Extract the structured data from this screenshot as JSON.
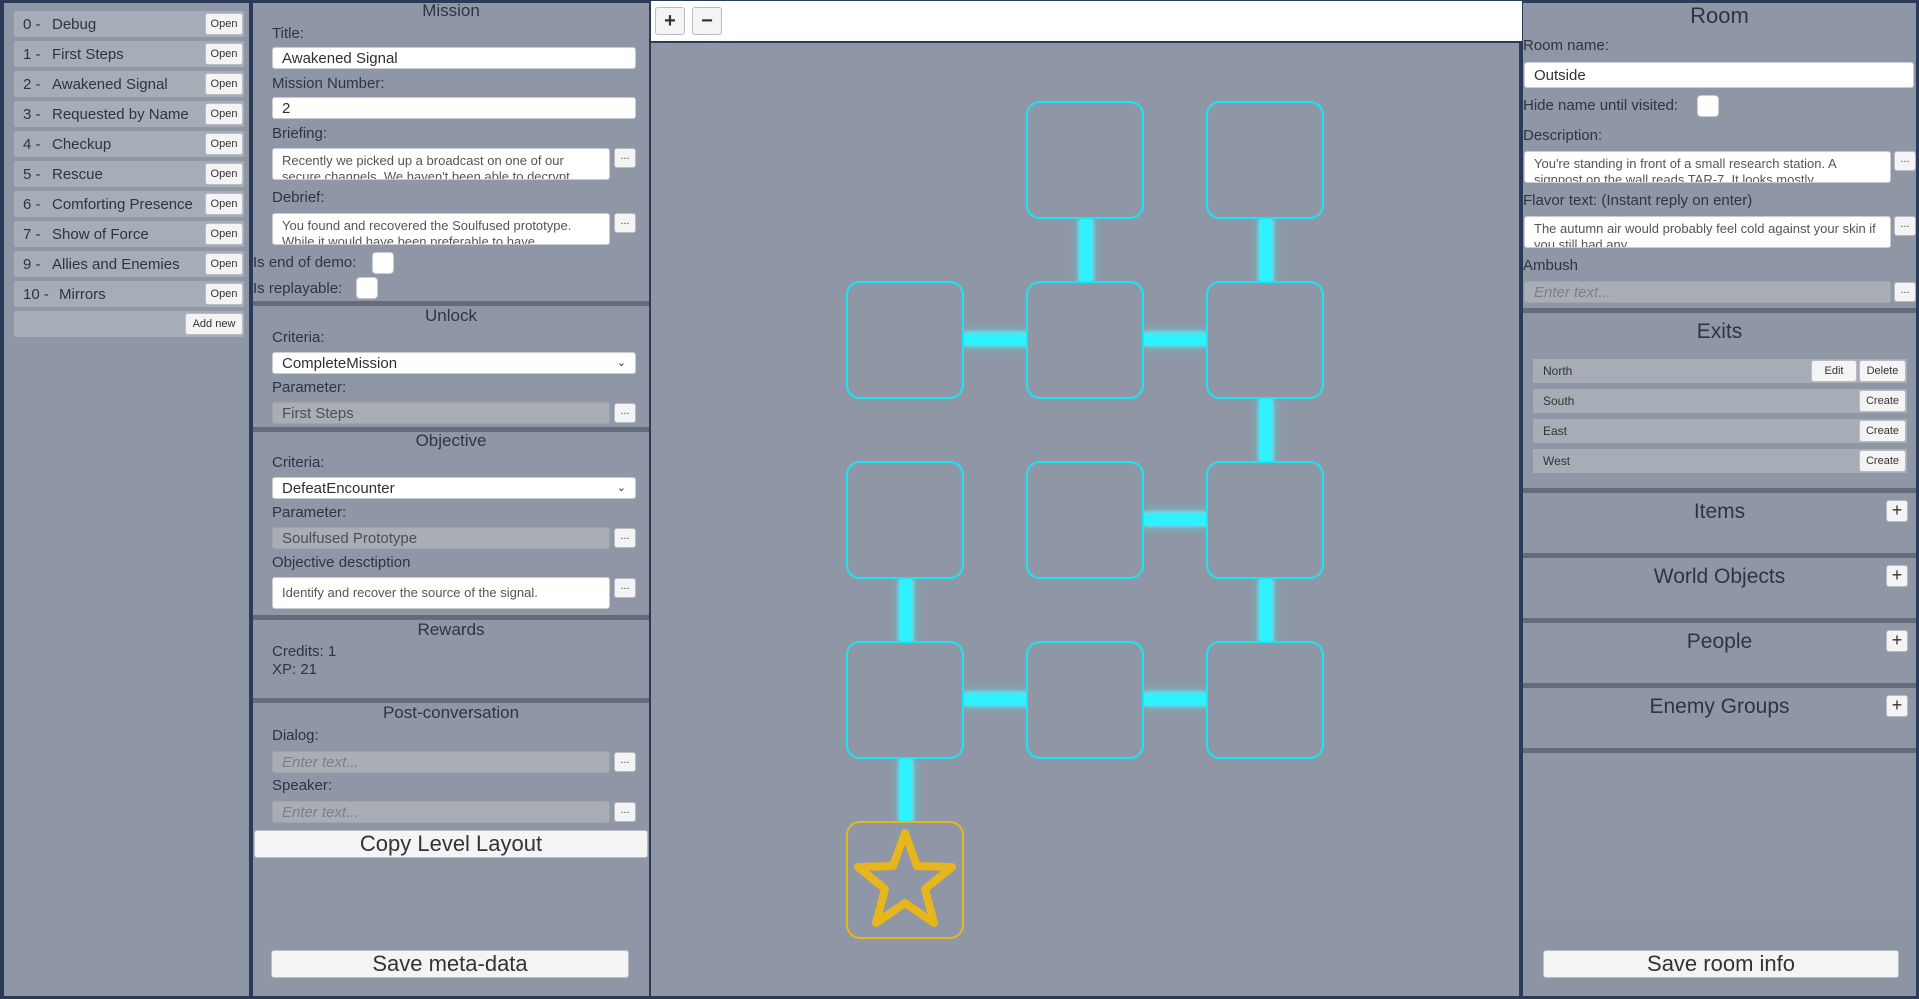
{
  "missions": {
    "items": [
      {
        "num": "0 -",
        "name": "Debug"
      },
      {
        "num": "1 -",
        "name": "First Steps"
      },
      {
        "num": "2 -",
        "name": "Awakened Signal"
      },
      {
        "num": "3 -",
        "name": "Requested by Name"
      },
      {
        "num": "4 -",
        "name": "Checkup"
      },
      {
        "num": "5 -",
        "name": "Rescue"
      },
      {
        "num": "6 -",
        "name": "Comforting Presence"
      },
      {
        "num": "7 -",
        "name": "Show of Force"
      },
      {
        "num": "9 -",
        "name": "Allies and Enemies"
      },
      {
        "num": "10 -",
        "name": "Mirrors"
      }
    ],
    "open_label": "Open",
    "add_new_label": "Add new"
  },
  "mission": {
    "header": "Mission",
    "title_label": "Title:",
    "title_value": "Awakened Signal",
    "number_label": "Mission Number:",
    "number_value": "2",
    "briefing_label": "Briefing:",
    "briefing_value": "Recently we picked up a broadcast on one of our secure channels. We haven't been able to decrypt",
    "debrief_label": "Debrief:",
    "debrief_value": "You found and recovered the Soulfused prototype. While it would have been preferable to have",
    "end_demo_label": "Is end of demo:",
    "replayable_label": "Is replayable:",
    "more_label": "..."
  },
  "unlock": {
    "header": "Unlock",
    "criteria_label": "Criteria:",
    "criteria_value": "CompleteMission",
    "parameter_label": "Parameter:",
    "parameter_value": "First Steps"
  },
  "objective": {
    "header": "Objective",
    "criteria_label": "Criteria:",
    "criteria_value": "DefeatEncounter",
    "parameter_label": "Parameter:",
    "parameter_value": "Soulfused Prototype",
    "description_label": "Objective desctiption",
    "description_value": "Identify and recover the source of the signal."
  },
  "rewards": {
    "header": "Rewards",
    "credits": "Credits: 1",
    "xp": "XP: 21"
  },
  "post": {
    "header": "Post-conversation",
    "dialog_label": "Dialog:",
    "speaker_label": "Speaker:",
    "placeholder": "Enter text..."
  },
  "actions": {
    "copy_layout": "Copy Level Layout",
    "save_meta": "Save meta-data",
    "save_room": "Save room info"
  },
  "map": {
    "zoom_in": "+",
    "zoom_out": "−",
    "accent_color": "#19e6f2",
    "selected_color": "#e7b51c"
  },
  "room": {
    "header": "Room",
    "name_label": "Room name:",
    "name_value": "Outside",
    "hide_label": "Hide name until visited:",
    "description_label": "Description:",
    "description_value": "You're standing in front of a small research station. A signpost on the wall reads TAR-7. It looks mostly",
    "flavor_label": "Flavor text: (Instant reply on enter)",
    "flavor_value": "The autumn air would probably feel cold against your skin if you still had any",
    "ambush_label": "Ambush",
    "ambush_placeholder": "Enter text...",
    "exits_header": "Exits",
    "exits": [
      {
        "dir": "North",
        "action": "Edit",
        "delete": "Delete"
      },
      {
        "dir": "South",
        "action": "Create"
      },
      {
        "dir": "East",
        "action": "Create"
      },
      {
        "dir": "West",
        "action": "Create"
      }
    ],
    "items_header": "Items",
    "world_objects_header": "World Objects",
    "people_header": "People",
    "enemy_groups_header": "Enemy Groups",
    "plus": "+"
  }
}
